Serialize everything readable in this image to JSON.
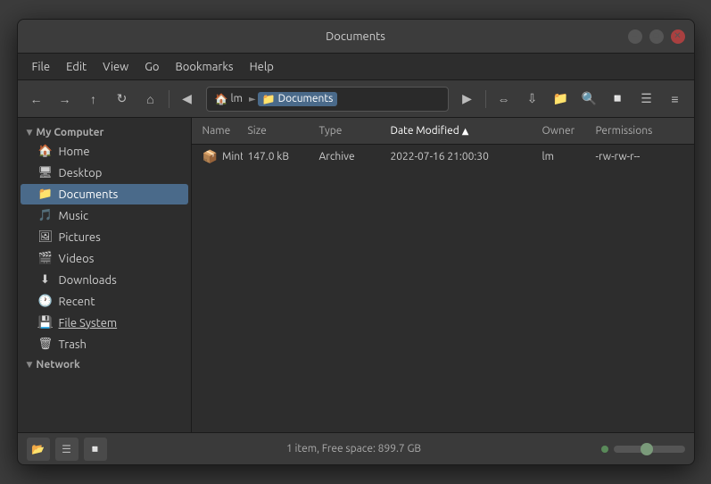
{
  "window": {
    "title": "Documents",
    "controls": {
      "minimize_label": "–",
      "maximize_label": "□",
      "close_label": "✕"
    }
  },
  "menubar": {
    "items": [
      {
        "label": "File",
        "id": "file"
      },
      {
        "label": "Edit",
        "id": "edit"
      },
      {
        "label": "View",
        "id": "view"
      },
      {
        "label": "Go",
        "id": "go"
      },
      {
        "label": "Bookmarks",
        "id": "bookmarks"
      },
      {
        "label": "Help",
        "id": "help"
      }
    ]
  },
  "toolbar": {
    "back_tooltip": "Back",
    "forward_tooltip": "Forward",
    "up_tooltip": "Up",
    "reload_tooltip": "Reload",
    "home_tooltip": "Home",
    "prev_breadcrumb": "◀",
    "next_breadcrumb": "▶",
    "breadcrumb_home_icon": "🏠",
    "breadcrumb_lm": "lm",
    "breadcrumb_documents": "Documents",
    "search_tooltip": "Search",
    "icon_view_tooltip": "Icon View",
    "list_view_tooltip": "List View",
    "compact_view_tooltip": "Compact View"
  },
  "sidebar": {
    "section_my_computer": "My Computer",
    "items_computer": [
      {
        "label": "Home",
        "icon": "🏠",
        "id": "home"
      },
      {
        "label": "Desktop",
        "icon": "🖥",
        "id": "desktop"
      },
      {
        "label": "Documents",
        "icon": "📁",
        "id": "documents",
        "active": true
      },
      {
        "label": "Music",
        "icon": "🎵",
        "id": "music"
      },
      {
        "label": "Pictures",
        "icon": "🖼",
        "id": "pictures"
      },
      {
        "label": "Videos",
        "icon": "🎬",
        "id": "videos"
      },
      {
        "label": "Downloads",
        "icon": "⬇",
        "id": "downloads"
      },
      {
        "label": "Recent",
        "icon": "🕐",
        "id": "recent"
      },
      {
        "label": "File System",
        "icon": "💾",
        "id": "filesystem"
      },
      {
        "label": "Trash",
        "icon": "🗑",
        "id": "trash"
      }
    ],
    "section_network": "Network"
  },
  "file_table": {
    "columns": [
      {
        "label": "Name",
        "id": "name"
      },
      {
        "label": "Size",
        "id": "size"
      },
      {
        "label": "Type",
        "id": "type"
      },
      {
        "label": "Date Modified",
        "id": "date",
        "sorted": true,
        "sort_dir": "▲"
      },
      {
        "label": "Owner",
        "id": "owner"
      },
      {
        "label": "Permissions",
        "id": "permissions"
      }
    ],
    "rows": [
      {
        "name": "Mint-X-Dark.zip",
        "icon": "📦",
        "size": "147.0 kB",
        "type": "Archive",
        "date_modified": "2022-07-16 21:00:30",
        "owner": "lm",
        "permissions": "-rw-rw-r--"
      }
    ]
  },
  "statusbar": {
    "status_text": "1 item, Free space: 899.7 GB"
  }
}
